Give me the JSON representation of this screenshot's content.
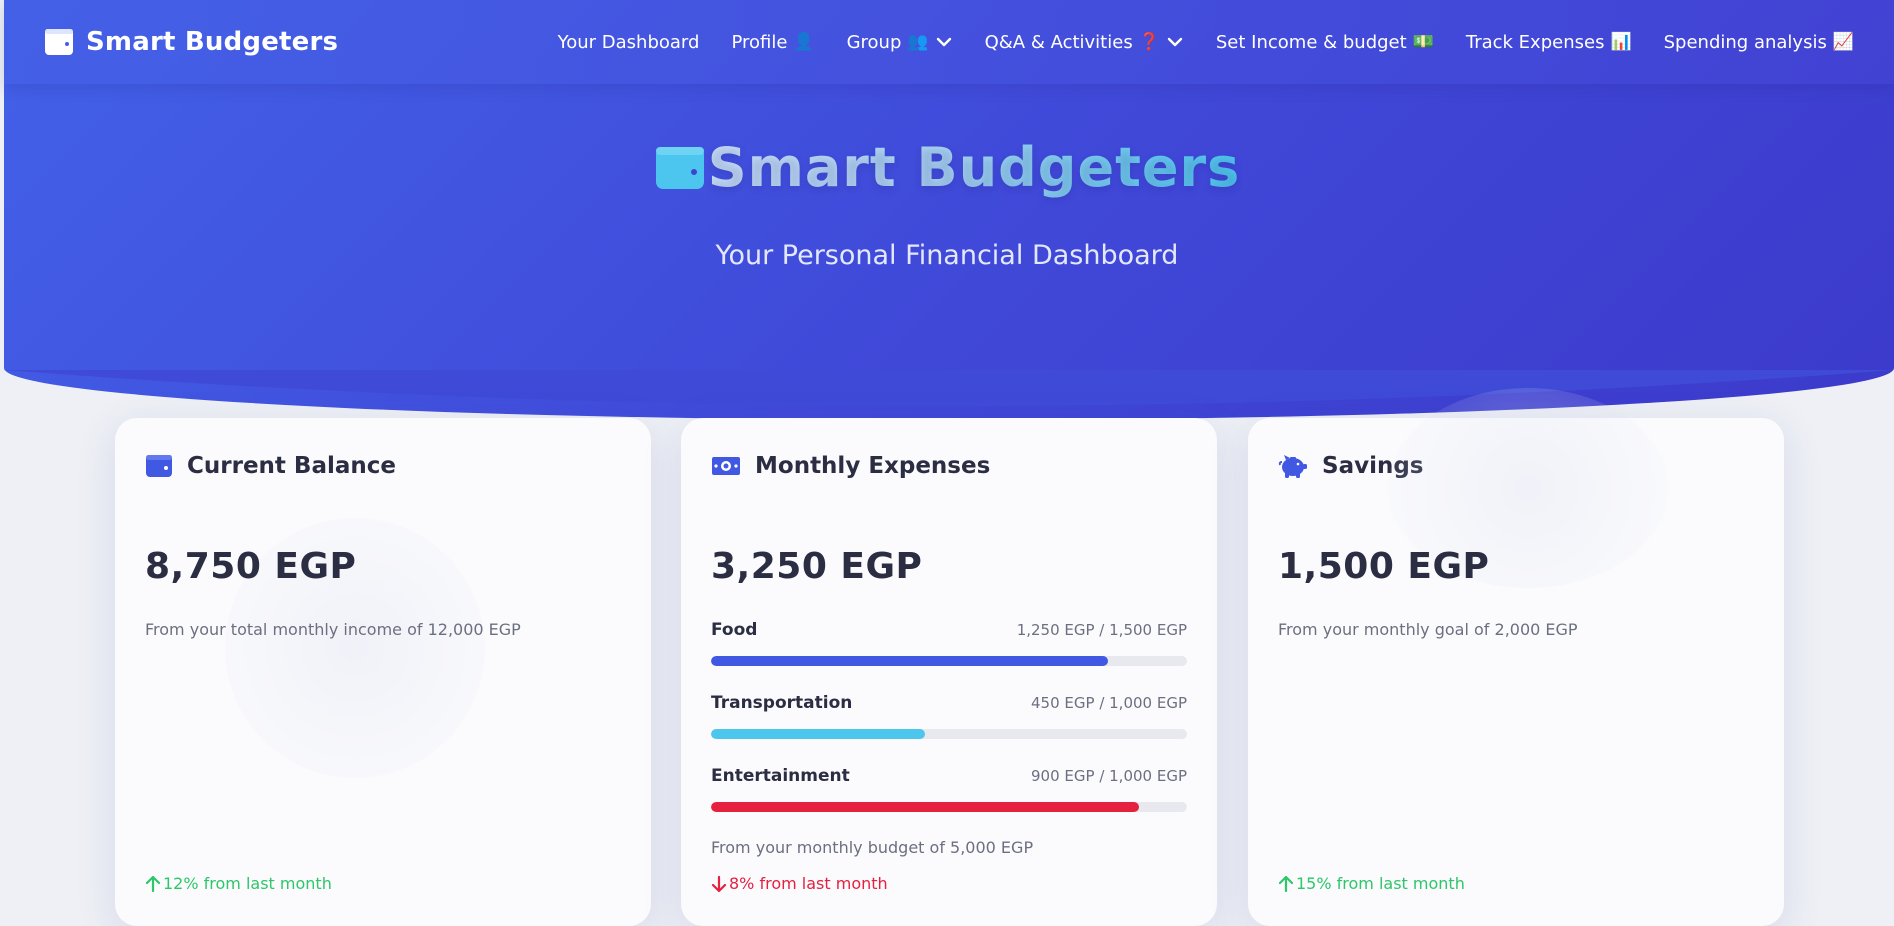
{
  "nav": {
    "brand": "Smart Budgeters",
    "links": [
      {
        "label": "Your Dashboard",
        "emoji": "",
        "dropdown": false
      },
      {
        "label": "Profile",
        "emoji": "👤",
        "dropdown": false
      },
      {
        "label": "Group",
        "emoji": "👥",
        "dropdown": true
      },
      {
        "label": "Q&A & Activities",
        "emoji": "❓",
        "dropdown": true
      },
      {
        "label": "Set Income & budget",
        "emoji": "💵",
        "dropdown": false
      },
      {
        "label": "Track Expenses",
        "emoji": "📊",
        "dropdown": false
      },
      {
        "label": "Spending analysis",
        "emoji": "📈",
        "dropdown": false
      }
    ]
  },
  "hero": {
    "title": "Smart Budgeters",
    "subtitle": "Your Personal Financial Dashboard"
  },
  "cards": {
    "balance": {
      "title": "Current Balance",
      "amount": "8,750 EGP",
      "note": "From your total monthly income of 12,000 EGP",
      "trend": "12% from last month"
    },
    "expenses": {
      "title": "Monthly Expenses",
      "amount": "3,250 EGP",
      "categories": [
        {
          "name": "Food",
          "value": "1,250 EGP / 1,500 EGP",
          "fraction": 0.8333,
          "color": "#4158e3"
        },
        {
          "name": "Transportation",
          "value": "450 EGP / 1,000 EGP",
          "fraction": 0.45,
          "color": "#4cc6ec"
        },
        {
          "name": "Entertainment",
          "value": "900 EGP / 1,000 EGP",
          "fraction": 0.9,
          "color": "#e5213f"
        }
      ],
      "note": "From your monthly budget of 5,000 EGP",
      "trend": "8% from last month"
    },
    "savings": {
      "title": "Savings",
      "amount": "1,500 EGP",
      "note": "From your monthly goal of 2,000 EGP",
      "trend": "15% from last month"
    }
  },
  "colors": {
    "primary": "#4158e3",
    "accent": "#4cc6ec",
    "positive": "#2ec66a",
    "negative": "#e5213f"
  }
}
